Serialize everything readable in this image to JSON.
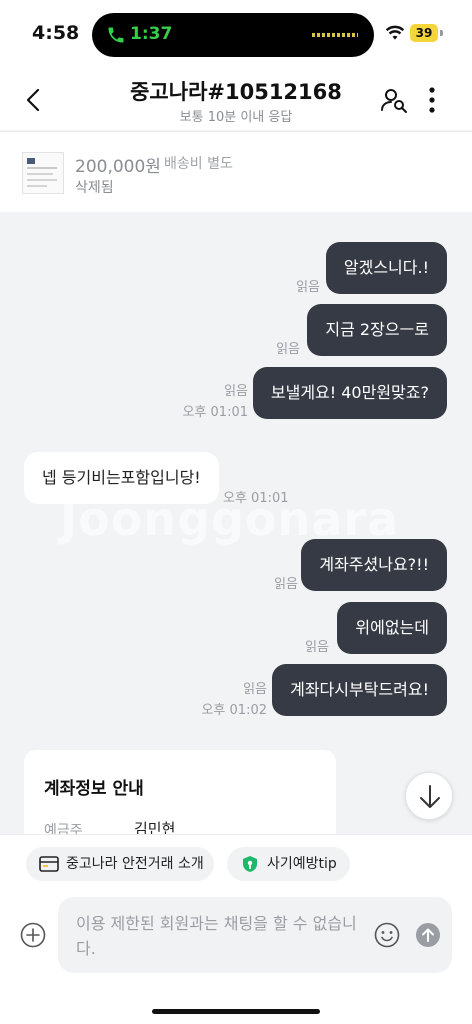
{
  "status_bar": {
    "time": "4:58",
    "call_time": "1:37",
    "battery": "39"
  },
  "header": {
    "title": "중고나라#10512168",
    "subtitle": "보통 10분 이내 응답"
  },
  "product": {
    "price": "200,000원",
    "shipping": "배송비 별도",
    "status": "삭제됨"
  },
  "chat": {
    "watermark": "Joonggonara",
    "messages": [
      {
        "side": "out",
        "text": "알겠스니다.!",
        "read": "읽음",
        "time": ""
      },
      {
        "side": "out",
        "text": "지금 2장으ㅡ로",
        "read": "읽음",
        "time": ""
      },
      {
        "side": "out",
        "text": "보낼게요! 40만원맞죠?",
        "read": "읽음",
        "time": "오후 01:01"
      },
      {
        "side": "in",
        "text": "넵 등기비는포함입니당!",
        "read": "",
        "time": "오후 01:01"
      },
      {
        "side": "out",
        "text": "계좌주셨나요?!!",
        "read": "읽음",
        "time": ""
      },
      {
        "side": "out",
        "text": "위에없는데",
        "read": "읽음",
        "time": ""
      },
      {
        "side": "out",
        "text": "계좌다시부탁드려요!",
        "read": "읽음",
        "time": "오후 01:02"
      }
    ],
    "account_card": {
      "title": "계좌정보 안내",
      "label": "예금주",
      "value": "김민현"
    }
  },
  "bottom": {
    "chips": [
      {
        "label": "중고나라 안전거래 소개",
        "icon": "card-icon"
      },
      {
        "label": "사기예방tip",
        "icon": "shield-icon"
      }
    ],
    "input_text": "이용 제한된 회원과는 채팅을 할 수 없습니다."
  },
  "colors": {
    "outgoing_bubble": "#363a45",
    "tip_icon": "#1fb86a"
  }
}
